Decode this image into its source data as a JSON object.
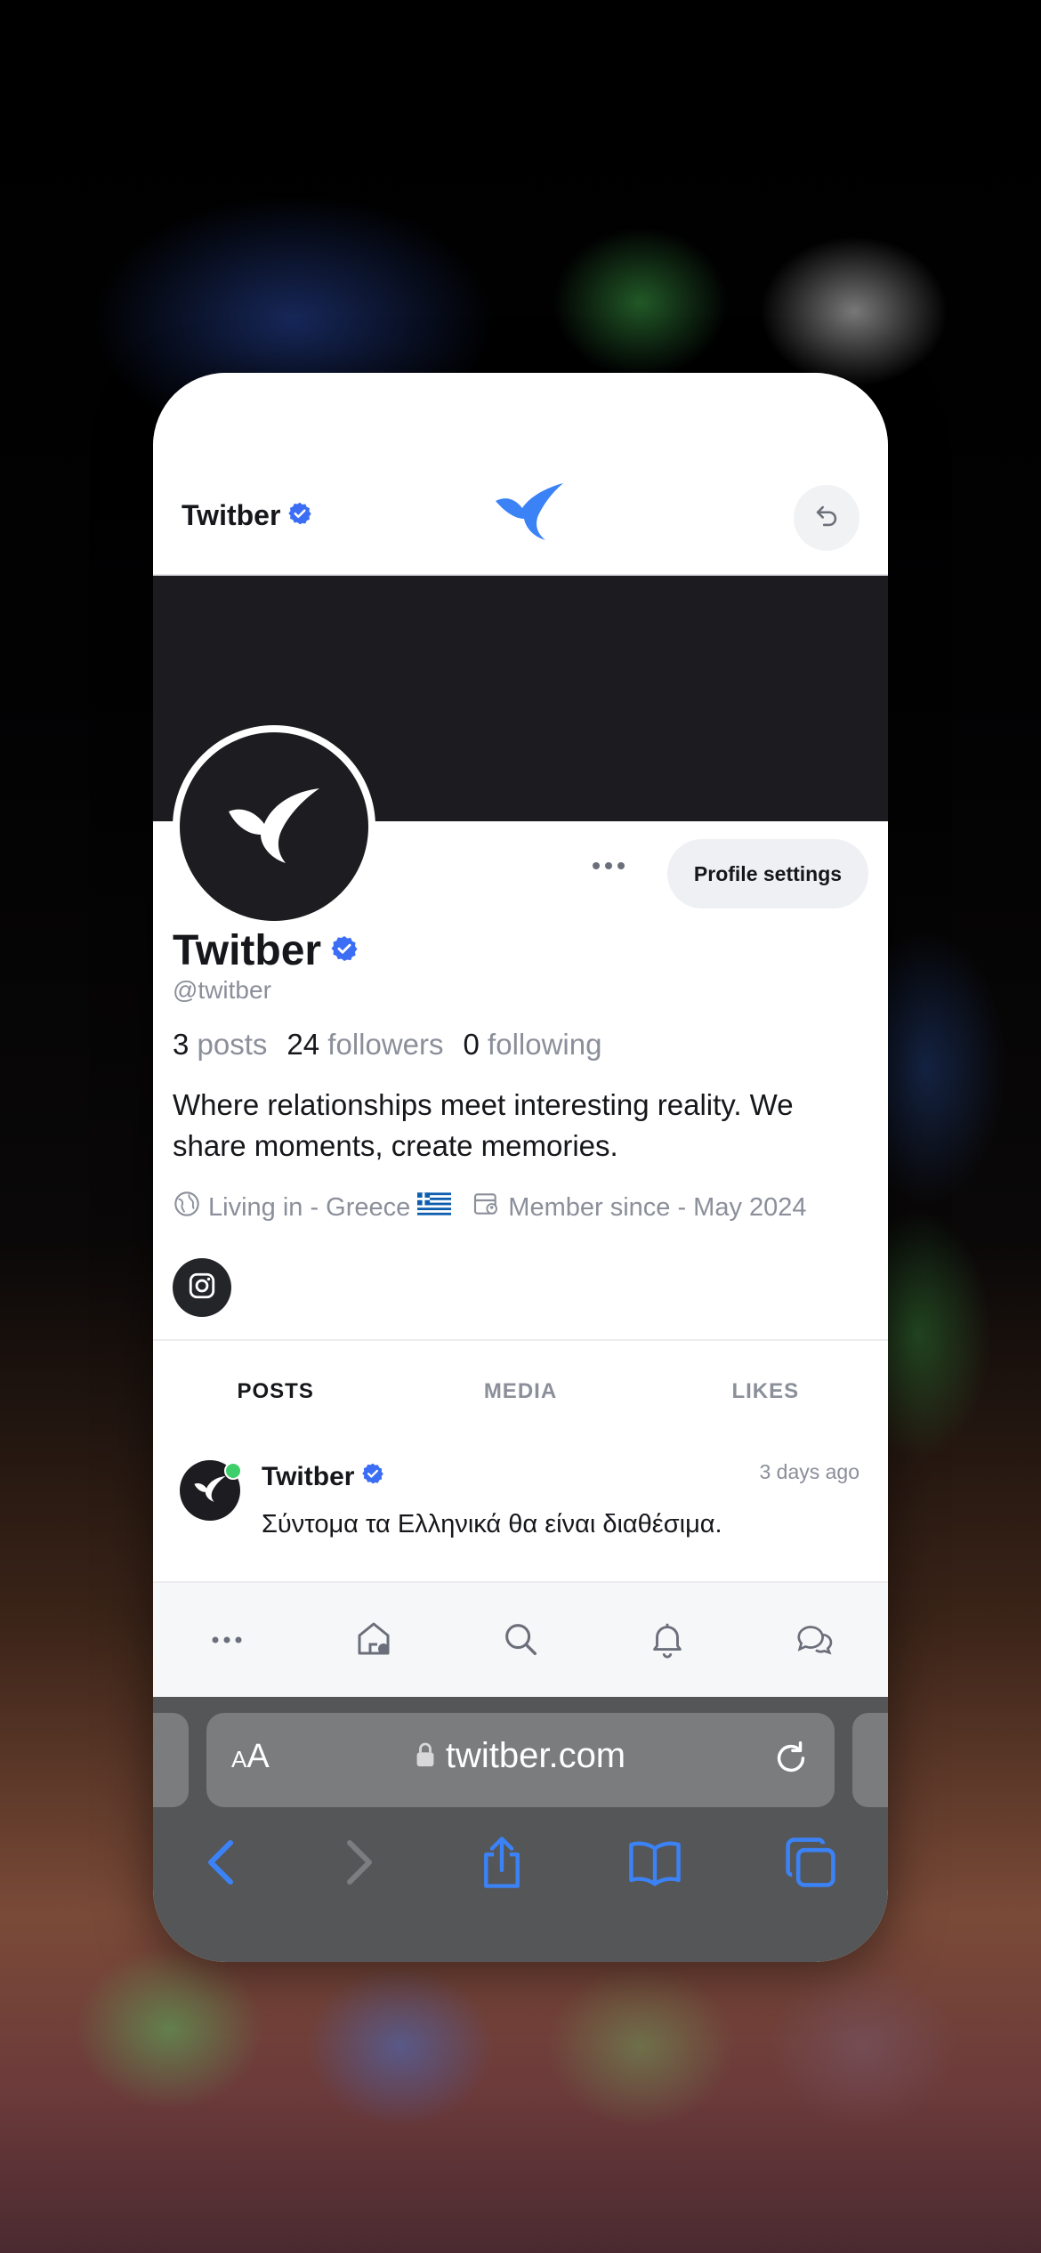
{
  "app": {
    "brand_name": "Twitber"
  },
  "profile": {
    "display_name": "Twitber",
    "handle": "@twitber",
    "settings_label": "Profile settings",
    "posts_count": "3",
    "posts_label": "posts",
    "followers_count": "24",
    "followers_label": "followers",
    "following_count": "0",
    "following_label": "following",
    "bio": "Where relationships meet interesting reality. We share moments, create memories.",
    "location": "Living in - Greece",
    "member_since": "Member since - May 2024"
  },
  "tabs": [
    {
      "label": "POSTS",
      "active": true
    },
    {
      "label": "MEDIA",
      "active": false
    },
    {
      "label": "LIKES",
      "active": false
    }
  ],
  "post": {
    "author": "Twitber",
    "time": "3 days ago",
    "text": "Σύντομα τα Ελληνικά θα είναι διαθέσιμα."
  },
  "browser": {
    "aa_label_small": "A",
    "aa_label_large": "A",
    "url": "twitber.com"
  },
  "colors": {
    "accent": "#3b82f6",
    "verified": "#3b6ef5",
    "dark": "#1c1c20"
  },
  "icons": [
    "verified-badge-icon",
    "bird-logo-icon",
    "undo-icon",
    "more-icon",
    "globe-icon",
    "greece-flag-icon",
    "calendar-user-icon",
    "instagram-icon",
    "home-icon",
    "search-icon",
    "bell-icon",
    "chat-icon",
    "lock-icon",
    "reload-icon",
    "back-arrow-icon",
    "forward-arrow-icon",
    "share-icon",
    "bookmarks-icon",
    "tabs-icon"
  ]
}
